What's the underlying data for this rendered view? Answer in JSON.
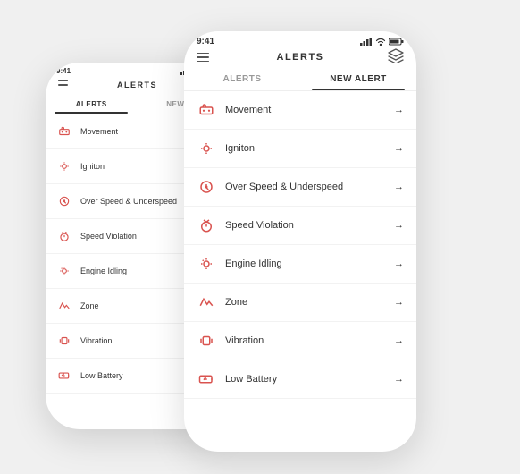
{
  "scene": {
    "bg": "#f0f0f0"
  },
  "phone_back": {
    "status_bar": {
      "time": "9:41"
    },
    "header": {
      "title": "ALERTS"
    },
    "tabs": [
      {
        "label": "ALERTS",
        "active": true
      },
      {
        "label": "NEW A...",
        "active": false
      }
    ],
    "alerts": [
      {
        "id": "movement",
        "label": "Movement"
      },
      {
        "id": "ignition",
        "label": "Igniton"
      },
      {
        "id": "overspeed",
        "label": "Over Speed & Underspeed"
      },
      {
        "id": "speed_violation",
        "label": "Speed Violation"
      },
      {
        "id": "engine_idling",
        "label": "Engine Idling"
      },
      {
        "id": "zone",
        "label": "Zone"
      },
      {
        "id": "vibration",
        "label": "Vibration"
      },
      {
        "id": "low_battery",
        "label": "Low Battery"
      }
    ]
  },
  "phone_front": {
    "status_bar": {
      "time": "9:41"
    },
    "header": {
      "title": "ALERTS"
    },
    "tabs": [
      {
        "label": "ALERTS",
        "active": false
      },
      {
        "label": "NEW ALERT",
        "active": true
      }
    ],
    "alerts": [
      {
        "id": "movement",
        "label": "Movement"
      },
      {
        "id": "ignition",
        "label": "Igniton"
      },
      {
        "id": "overspeed",
        "label": "Over Speed & Underspeed"
      },
      {
        "id": "speed_violation",
        "label": "Speed Violation"
      },
      {
        "id": "engine_idling",
        "label": "Engine Idling"
      },
      {
        "id": "zone",
        "label": "Zone"
      },
      {
        "id": "vibration",
        "label": "Vibration"
      },
      {
        "id": "low_battery",
        "label": "Low Battery"
      }
    ]
  }
}
